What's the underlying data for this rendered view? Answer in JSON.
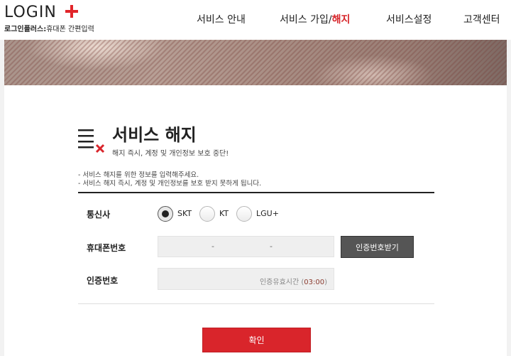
{
  "header": {
    "logo_text": "LOGIN",
    "logo_sub_bold": "로그인플러스:",
    "logo_sub_rest": "휴대폰 간편입력",
    "nav": [
      {
        "label": "서비스 안내"
      },
      {
        "label": "서비스 가입/",
        "accent": "해지"
      },
      {
        "label": "서비스설정"
      },
      {
        "label": "고객센터"
      }
    ]
  },
  "page": {
    "title": "서비스 해지",
    "subtitle": "해지 즉시, 계정 및 개인정보 보호 중단!",
    "notice_lines": [
      "- 서비스 해지를 위한 정보를 입력해주세요.",
      "- 서비스 해지 즉시, 계정 및 개인정보를 보호 받지 못하게 됩니다."
    ]
  },
  "form": {
    "carrier_label": "통신사",
    "carriers": [
      {
        "label": "SKT",
        "checked": true
      },
      {
        "label": "KT",
        "checked": false
      },
      {
        "label": "LGU+",
        "checked": false
      }
    ],
    "phone_label": "휴대폰번호",
    "phone_separators": [
      "-",
      "-"
    ],
    "send_code_button": "인증번호받기",
    "code_label": "인증번호",
    "timer_text": "인증유효시간 (",
    "timer_value": "03:00",
    "timer_close": ")",
    "confirm_button": "확인"
  },
  "colors": {
    "accent": "#d9252b",
    "dark_button": "#555555"
  }
}
